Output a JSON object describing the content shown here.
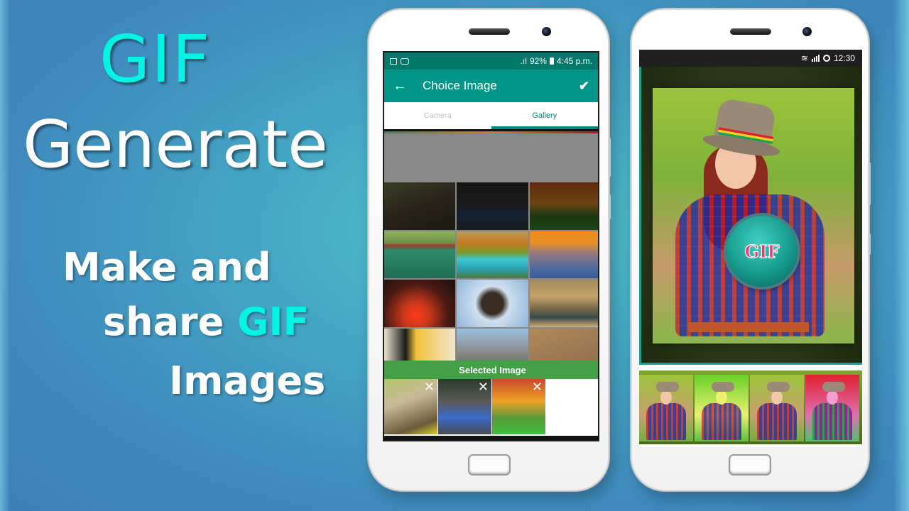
{
  "promo": {
    "line1": "GIF",
    "line2": "Generate",
    "sub1": "Make and",
    "sub2_prefix": "share ",
    "sub2_accent": "GIF",
    "sub3": "Images"
  },
  "colors": {
    "accent_cyan": "#00f5e4",
    "teal_primary": "#009688",
    "teal_dark": "#00796b",
    "selected_green": "#43a047"
  },
  "phone1": {
    "status_bar": {
      "left_icons": [
        "image-icon",
        "message-icon"
      ],
      "signal_icon": "signal-icon",
      "battery_percent": "92%",
      "battery_icon": "battery-icon",
      "time": "4:45 p.m."
    },
    "app_bar": {
      "back_icon": "←",
      "title": "Choice Image",
      "confirm_icon": "✔"
    },
    "tabs": [
      {
        "label": "Camera",
        "active": false
      },
      {
        "label": "Gallery",
        "active": true
      }
    ],
    "gallery": [
      {
        "name": "hawks",
        "selected": true
      },
      {
        "name": "glowing-beach",
        "selected": true
      },
      {
        "name": "sunset-field",
        "selected": true
      },
      {
        "name": "lake-house",
        "selected": false
      },
      {
        "name": "turquoise-river",
        "selected": false
      },
      {
        "name": "orange-sea-dolphins",
        "selected": false
      },
      {
        "name": "palm-sunset",
        "selected": false
      },
      {
        "name": "eagles",
        "selected": false
      },
      {
        "name": "desert-camels",
        "selected": false
      },
      {
        "name": "penguins",
        "selected": false
      },
      {
        "name": "mountain",
        "selected": false
      },
      {
        "name": "sand",
        "selected": false
      }
    ],
    "selected_header": "Selected Image",
    "selected_images": [
      {
        "name": "hawks",
        "remove_icon": "✕"
      },
      {
        "name": "glowing-beach",
        "remove_icon": "✕"
      },
      {
        "name": "sunset-field",
        "remove_icon": "✕"
      }
    ]
  },
  "phone2": {
    "status_bar": {
      "wifi_icon": "wifi-icon",
      "signal_icon": "signal-icon",
      "sync_icon": "circle-icon",
      "time": "12:30"
    },
    "gif_button_label": "GIF",
    "frames": [
      {
        "name": "frame-original"
      },
      {
        "name": "frame-yellow-tint"
      },
      {
        "name": "frame-mirrored"
      },
      {
        "name": "frame-magenta-tint"
      }
    ]
  }
}
